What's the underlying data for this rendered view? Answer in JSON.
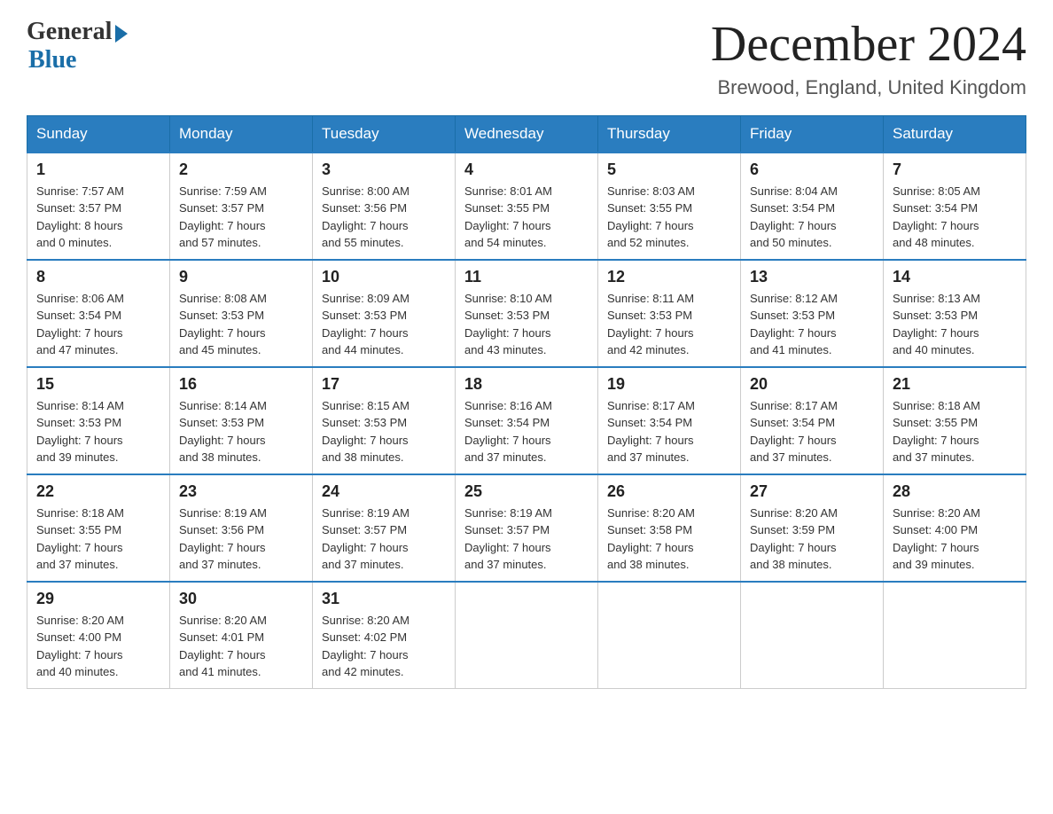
{
  "header": {
    "logo": {
      "general": "General",
      "blue": "Blue"
    },
    "title": "December 2024",
    "location": "Brewood, England, United Kingdom"
  },
  "days_of_week": [
    "Sunday",
    "Monday",
    "Tuesday",
    "Wednesday",
    "Thursday",
    "Friday",
    "Saturday"
  ],
  "weeks": [
    [
      {
        "day": "1",
        "sunrise": "7:57 AM",
        "sunset": "3:57 PM",
        "daylight": "8 hours and 0 minutes."
      },
      {
        "day": "2",
        "sunrise": "7:59 AM",
        "sunset": "3:57 PM",
        "daylight": "7 hours and 57 minutes."
      },
      {
        "day": "3",
        "sunrise": "8:00 AM",
        "sunset": "3:56 PM",
        "daylight": "7 hours and 55 minutes."
      },
      {
        "day": "4",
        "sunrise": "8:01 AM",
        "sunset": "3:55 PM",
        "daylight": "7 hours and 54 minutes."
      },
      {
        "day": "5",
        "sunrise": "8:03 AM",
        "sunset": "3:55 PM",
        "daylight": "7 hours and 52 minutes."
      },
      {
        "day": "6",
        "sunrise": "8:04 AM",
        "sunset": "3:54 PM",
        "daylight": "7 hours and 50 minutes."
      },
      {
        "day": "7",
        "sunrise": "8:05 AM",
        "sunset": "3:54 PM",
        "daylight": "7 hours and 48 minutes."
      }
    ],
    [
      {
        "day": "8",
        "sunrise": "8:06 AM",
        "sunset": "3:54 PM",
        "daylight": "7 hours and 47 minutes."
      },
      {
        "day": "9",
        "sunrise": "8:08 AM",
        "sunset": "3:53 PM",
        "daylight": "7 hours and 45 minutes."
      },
      {
        "day": "10",
        "sunrise": "8:09 AM",
        "sunset": "3:53 PM",
        "daylight": "7 hours and 44 minutes."
      },
      {
        "day": "11",
        "sunrise": "8:10 AM",
        "sunset": "3:53 PM",
        "daylight": "7 hours and 43 minutes."
      },
      {
        "day": "12",
        "sunrise": "8:11 AM",
        "sunset": "3:53 PM",
        "daylight": "7 hours and 42 minutes."
      },
      {
        "day": "13",
        "sunrise": "8:12 AM",
        "sunset": "3:53 PM",
        "daylight": "7 hours and 41 minutes."
      },
      {
        "day": "14",
        "sunrise": "8:13 AM",
        "sunset": "3:53 PM",
        "daylight": "7 hours and 40 minutes."
      }
    ],
    [
      {
        "day": "15",
        "sunrise": "8:14 AM",
        "sunset": "3:53 PM",
        "daylight": "7 hours and 39 minutes."
      },
      {
        "day": "16",
        "sunrise": "8:14 AM",
        "sunset": "3:53 PM",
        "daylight": "7 hours and 38 minutes."
      },
      {
        "day": "17",
        "sunrise": "8:15 AM",
        "sunset": "3:53 PM",
        "daylight": "7 hours and 38 minutes."
      },
      {
        "day": "18",
        "sunrise": "8:16 AM",
        "sunset": "3:54 PM",
        "daylight": "7 hours and 37 minutes."
      },
      {
        "day": "19",
        "sunrise": "8:17 AM",
        "sunset": "3:54 PM",
        "daylight": "7 hours and 37 minutes."
      },
      {
        "day": "20",
        "sunrise": "8:17 AM",
        "sunset": "3:54 PM",
        "daylight": "7 hours and 37 minutes."
      },
      {
        "day": "21",
        "sunrise": "8:18 AM",
        "sunset": "3:55 PM",
        "daylight": "7 hours and 37 minutes."
      }
    ],
    [
      {
        "day": "22",
        "sunrise": "8:18 AM",
        "sunset": "3:55 PM",
        "daylight": "7 hours and 37 minutes."
      },
      {
        "day": "23",
        "sunrise": "8:19 AM",
        "sunset": "3:56 PM",
        "daylight": "7 hours and 37 minutes."
      },
      {
        "day": "24",
        "sunrise": "8:19 AM",
        "sunset": "3:57 PM",
        "daylight": "7 hours and 37 minutes."
      },
      {
        "day": "25",
        "sunrise": "8:19 AM",
        "sunset": "3:57 PM",
        "daylight": "7 hours and 37 minutes."
      },
      {
        "day": "26",
        "sunrise": "8:20 AM",
        "sunset": "3:58 PM",
        "daylight": "7 hours and 38 minutes."
      },
      {
        "day": "27",
        "sunrise": "8:20 AM",
        "sunset": "3:59 PM",
        "daylight": "7 hours and 38 minutes."
      },
      {
        "day": "28",
        "sunrise": "8:20 AM",
        "sunset": "4:00 PM",
        "daylight": "7 hours and 39 minutes."
      }
    ],
    [
      {
        "day": "29",
        "sunrise": "8:20 AM",
        "sunset": "4:00 PM",
        "daylight": "7 hours and 40 minutes."
      },
      {
        "day": "30",
        "sunrise": "8:20 AM",
        "sunset": "4:01 PM",
        "daylight": "7 hours and 41 minutes."
      },
      {
        "day": "31",
        "sunrise": "8:20 AM",
        "sunset": "4:02 PM",
        "daylight": "7 hours and 42 minutes."
      },
      null,
      null,
      null,
      null
    ]
  ],
  "labels": {
    "sunrise": "Sunrise:",
    "sunset": "Sunset:",
    "daylight": "Daylight:"
  }
}
